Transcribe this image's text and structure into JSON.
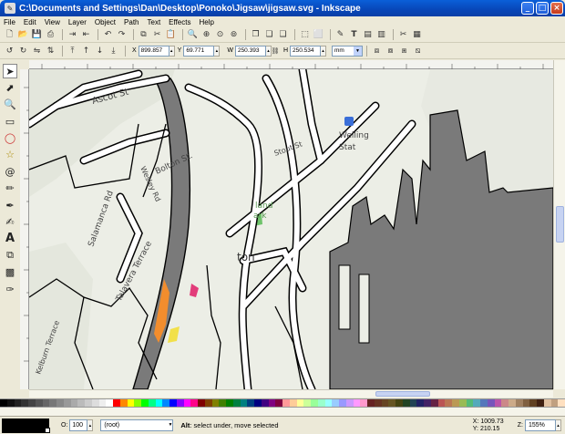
{
  "window": {
    "title": "C:\\Documents and Settings\\Dan\\Desktop\\Ponoko\\Jigsaw\\jigsaw.svg - Inkscape"
  },
  "menu": [
    "File",
    "Edit",
    "View",
    "Layer",
    "Object",
    "Path",
    "Text",
    "Effects",
    "Help"
  ],
  "controls": {
    "x_label": "X",
    "x_value": "899.857",
    "y_label": "Y",
    "y_value": "69.771",
    "w_label": "W",
    "w_value": "250.393",
    "h_label": "H",
    "h_value": "250.534",
    "unit": "mm"
  },
  "map_labels": {
    "ascot": "Ascot St",
    "bolton": "Bolton St.",
    "wesley": "Wesley Rd",
    "salamanca": "Salamanca Rd",
    "talavera": "Talavera Terrace",
    "kelburn": "Kelburn Terrace",
    "stout": "Stout St",
    "welling": "Welling",
    "stat": "Stat",
    "land": "land",
    "ark": "ark",
    "ton": "ton"
  },
  "palette_colors": [
    "#000000",
    "#111111",
    "#222222",
    "#333333",
    "#444444",
    "#555555",
    "#666666",
    "#777777",
    "#888888",
    "#999999",
    "#aaaaaa",
    "#bbbbbb",
    "#cccccc",
    "#dddddd",
    "#eeeeee",
    "#ffffff",
    "#ff0000",
    "#ff8800",
    "#ffff00",
    "#88ff00",
    "#00ff00",
    "#00ff88",
    "#00ffff",
    "#0088ff",
    "#0000ff",
    "#8800ff",
    "#ff00ff",
    "#ff0088",
    "#800000",
    "#804000",
    "#808000",
    "#408000",
    "#008000",
    "#008040",
    "#008080",
    "#004080",
    "#000080",
    "#400080",
    "#800080",
    "#800040",
    "#ff9999",
    "#ffcc99",
    "#ffff99",
    "#ccff99",
    "#99ff99",
    "#99ffcc",
    "#99ffff",
    "#99ccff",
    "#9999ff",
    "#cc99ff",
    "#ff99ff",
    "#ff99cc",
    "#662222",
    "#663322",
    "#664422",
    "#665522",
    "#444411",
    "#224422",
    "#224455",
    "#222266",
    "#442266",
    "#662244",
    "#bb5555",
    "#bb7755",
    "#bb9955",
    "#99bb55",
    "#55bb77",
    "#55aabb",
    "#5577bb",
    "#7755bb",
    "#bb55aa",
    "#cc8888",
    "#ccaa88",
    "#a08060",
    "#806040",
    "#604020",
    "#402010",
    "#e0c0a0",
    "#c0a080",
    "#ffe0c0"
  ],
  "status": {
    "opacity_label": "O:",
    "opacity_value": "100",
    "layer": "(root)",
    "message_bold": "Alt",
    "message": ": select under, move selected",
    "x": "X: 1009.73",
    "y": "Y: 210.15",
    "zoom_label": "Z:",
    "zoom": "155%"
  },
  "colors": {
    "titlebar": "#0a5fd8",
    "water": "#7a7a7a",
    "map_bg": "#eceee6",
    "road": "#ffffff"
  }
}
